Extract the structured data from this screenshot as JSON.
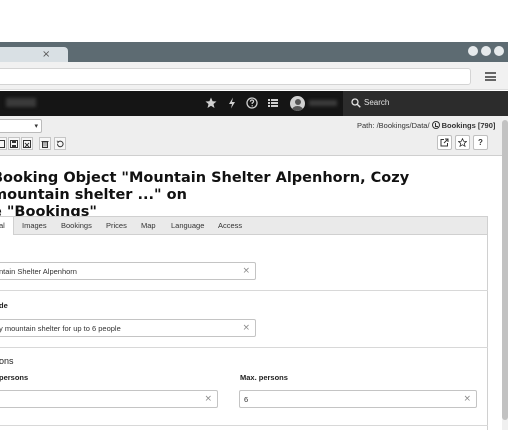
{
  "browser": {
    "tab_close": "×"
  },
  "topbar": {
    "search_label": "Search"
  },
  "docheader": {
    "path_label": "Path: /Bookings/Data/",
    "path_current": "Bookings [790]",
    "help_label": "?",
    "select_chevron": "▾"
  },
  "page": {
    "title": "Booking Object \"Mountain Shelter Alpenhorn, Cozy mountain shelter ...\" on\ne \"Bookings\""
  },
  "tabs": [
    {
      "label": "al"
    },
    {
      "label": "Images"
    },
    {
      "label": "Bookings"
    },
    {
      "label": "Prices"
    },
    {
      "label": "Map"
    },
    {
      "label": "Language"
    },
    {
      "label": "Access"
    }
  ],
  "form": {
    "title_value": "ntain Shelter Alpenhorn",
    "subtitle_label": "de",
    "subtitle_value": "y mountain shelter for up to 6 people",
    "persons_section": "ons",
    "min_persons_label": "persons",
    "max_persons_label": "Max. persons",
    "max_persons_value": "6",
    "clear_glyph": "×"
  }
}
